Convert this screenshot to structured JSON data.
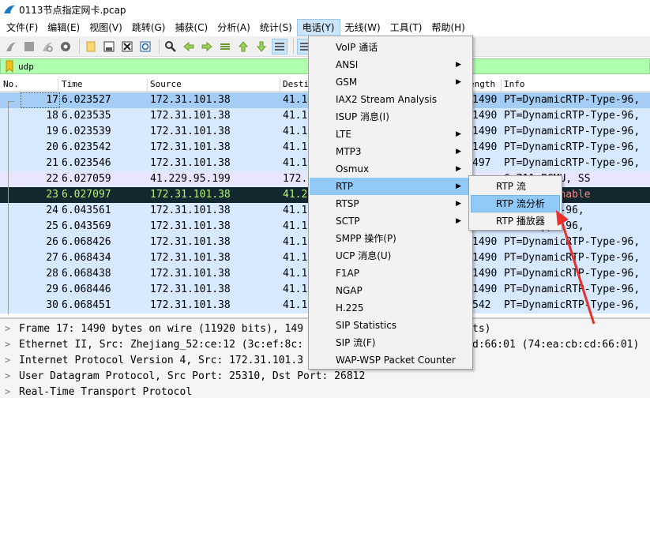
{
  "window": {
    "title": "0113节点指定网卡.pcap"
  },
  "menubar": [
    {
      "label": "文件(F)"
    },
    {
      "label": "编辑(E)"
    },
    {
      "label": "视图(V)"
    },
    {
      "label": "跳转(G)"
    },
    {
      "label": "捕获(C)"
    },
    {
      "label": "分析(A)"
    },
    {
      "label": "统计(S)"
    },
    {
      "label": "电话(Y)"
    },
    {
      "label": "无线(W)"
    },
    {
      "label": "工具(T)"
    },
    {
      "label": "帮助(H)"
    }
  ],
  "filter": {
    "value": "udp"
  },
  "columns": {
    "no": "No.",
    "time": "Time",
    "source": "Source",
    "destination": "Desti",
    "length": "ength",
    "info": "Info"
  },
  "packets": [
    {
      "no": "17",
      "time": "6.023527",
      "src": "172.31.101.38",
      "dst": "41.1",
      "len": "1490",
      "info": "PT=DynamicRTP-Type-96,"
    },
    {
      "no": "18",
      "time": "6.023535",
      "src": "172.31.101.38",
      "dst": "41.1",
      "len": "1490",
      "info": "PT=DynamicRTP-Type-96,"
    },
    {
      "no": "19",
      "time": "6.023539",
      "src": "172.31.101.38",
      "dst": "41.1",
      "len": "1490",
      "info": "PT=DynamicRTP-Type-96,"
    },
    {
      "no": "20",
      "time": "6.023542",
      "src": "172.31.101.38",
      "dst": "41.1",
      "len": "1490",
      "info": "PT=DynamicRTP-Type-96,"
    },
    {
      "no": "21",
      "time": "6.023546",
      "src": "172.31.101.38",
      "dst": "41.1",
      "len": "497",
      "info": "PT=DynamicRTP-Type-96,"
    },
    {
      "no": "22",
      "time": "6.027059",
      "src": "41.229.95.199",
      "dst": "172.",
      "len": "",
      "info": "6.711 PCMU, SS"
    },
    {
      "no": "23",
      "time": "6.027097",
      "src": "172.31.101.38",
      "dst": "41.2",
      "len": "",
      "info": "on unreachable"
    },
    {
      "no": "24",
      "time": "6.043561",
      "src": "172.31.101.38",
      "dst": "41.1",
      "len": "",
      "info": "cRTP-Type-96,"
    },
    {
      "no": "25",
      "time": "6.043569",
      "src": "172.31.101.38",
      "dst": "41.1",
      "len": "",
      "info": "cRTP-Type-96,"
    },
    {
      "no": "26",
      "time": "6.068426",
      "src": "172.31.101.38",
      "dst": "41.1",
      "len": "1490",
      "info": "PT=DynamicRTP-Type-96,"
    },
    {
      "no": "27",
      "time": "6.068434",
      "src": "172.31.101.38",
      "dst": "41.1",
      "len": "1490",
      "info": "PT=DynamicRTP-Type-96,"
    },
    {
      "no": "28",
      "time": "6.068438",
      "src": "172.31.101.38",
      "dst": "41.1",
      "len": "1490",
      "info": "PT=DynamicRTP-Type-96,"
    },
    {
      "no": "29",
      "time": "6.068446",
      "src": "172.31.101.38",
      "dst": "41.1",
      "len": "1490",
      "info": "PT=DynamicRTP-Type-96,"
    },
    {
      "no": "30",
      "time": "6.068451",
      "src": "172.31.101.38",
      "dst": "41.1",
      "len": "542",
      "info": "PT=DynamicRTP-Type-96,"
    }
  ],
  "details": [
    {
      "text": "Frame 17: 1490 bytes on wire (11920 bits), 149",
      "tail": "ts)"
    },
    {
      "text": "Ethernet II, Src: Zhejiang_52:ce:12 (3c:ef:8c:",
      "tail": "d:66:01 (74:ea:cb:cd:66:01)"
    },
    {
      "text": "Internet Protocol Version 4, Src: 172.31.101.3",
      "tail": ""
    },
    {
      "text": "User Datagram Protocol, Src Port: 25310, Dst Port: 26812",
      "tail": ""
    },
    {
      "text": "Real-Time Transport Protocol",
      "tail": ""
    }
  ],
  "telephony_menu": [
    {
      "label": "VoIP 通话",
      "submenu": false
    },
    {
      "label": "ANSI",
      "submenu": true
    },
    {
      "label": "GSM",
      "submenu": true
    },
    {
      "label": "IAX2 Stream Analysis",
      "submenu": false
    },
    {
      "label": "ISUP 消息(I)",
      "submenu": false
    },
    {
      "label": "LTE",
      "submenu": true
    },
    {
      "label": "MTP3",
      "submenu": true
    },
    {
      "label": "Osmux",
      "submenu": true
    },
    {
      "label": "RTP",
      "submenu": true,
      "highlighted": true
    },
    {
      "label": "RTSP",
      "submenu": true
    },
    {
      "label": "SCTP",
      "submenu": true
    },
    {
      "label": "SMPP 操作(P)",
      "submenu": false
    },
    {
      "label": "UCP 消息(U)",
      "submenu": false
    },
    {
      "label": "F1AP",
      "submenu": false
    },
    {
      "label": "NGAP",
      "submenu": false
    },
    {
      "label": "H.225",
      "submenu": false
    },
    {
      "label": "SIP Statistics",
      "submenu": false
    },
    {
      "label": "SIP 流(F)",
      "submenu": false
    },
    {
      "label": "WAP-WSP Packet Counter",
      "submenu": false
    }
  ],
  "rtp_submenu": [
    {
      "label": "RTP 流"
    },
    {
      "label": "RTP 流分析",
      "highlighted": true
    },
    {
      "label": "RTP 播放器"
    }
  ],
  "icons": {
    "toolbar": [
      "start-capture-icon",
      "stop-capture-icon",
      "restart-capture-icon",
      "capture-options-icon",
      "open-file-icon",
      "save-file-icon",
      "close-file-icon",
      "reload-file-icon",
      "find-packet-icon",
      "go-back-icon",
      "go-forward-icon",
      "go-to-packet-icon",
      "go-first-icon",
      "go-last-icon",
      "auto-scroll-icon",
      "colorize-icon"
    ]
  },
  "colors": {
    "filter_bg": "#afffaf",
    "rtp_row": "#d7e9ff",
    "selected_row": "#a3cdf5",
    "error_row_bg": "#12272e",
    "menu_highlight": "#91c9f7",
    "annotation_arrow": "#e8302a"
  }
}
